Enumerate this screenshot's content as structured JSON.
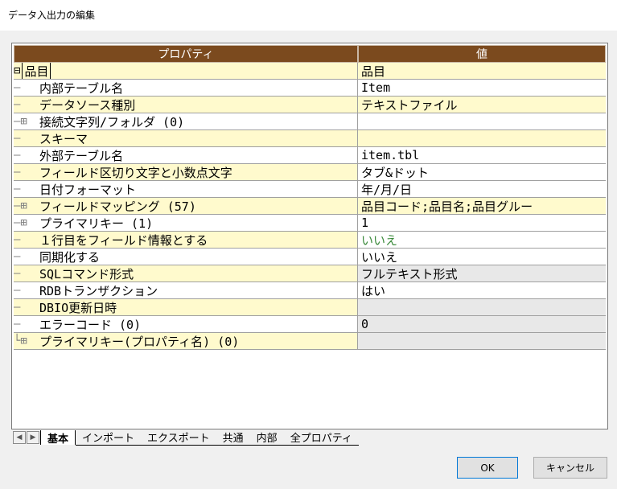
{
  "window": {
    "title": "データ入出力の編集"
  },
  "grid": {
    "headers": {
      "property": "プロパティ",
      "value": "値"
    },
    "rows": [
      {
        "tree": "⊟",
        "label": "品目",
        "value": "品目",
        "bg": "yellow",
        "vbg": "yellow",
        "root": true
      },
      {
        "tree": "―",
        "label": "内部テーブル名",
        "value": "Item",
        "bg": "white",
        "vbg": "white"
      },
      {
        "tree": "―",
        "label": "データソース種別",
        "value": "テキストファイル",
        "bg": "yellow",
        "vbg": "yellow"
      },
      {
        "tree": "―⊞",
        "label": "接続文字列/フォルダ (0)",
        "value": "",
        "bg": "white",
        "vbg": "white"
      },
      {
        "tree": "―",
        "label": "スキーマ",
        "value": "",
        "bg": "yellow",
        "vbg": "yellow"
      },
      {
        "tree": "―",
        "label": "外部テーブル名",
        "value": "item.tbl",
        "bg": "white",
        "vbg": "white"
      },
      {
        "tree": "―",
        "label": "フィールド区切り文字と小数点文字",
        "value": "タブ&ドット",
        "bg": "yellow",
        "vbg": "white"
      },
      {
        "tree": "―",
        "label": "日付フォーマット",
        "value": "年/月/日",
        "bg": "white",
        "vbg": "white"
      },
      {
        "tree": "―⊞",
        "label": "フィールドマッピング (57)",
        "value": "品目コード;品目名;品目グルー",
        "bg": "yellow",
        "vbg": "yellow"
      },
      {
        "tree": "―⊞",
        "label": "プライマリキー (1)",
        "value": "1",
        "bg": "white",
        "vbg": "white"
      },
      {
        "tree": "―",
        "label": "１行目をフィールド情報とする",
        "value": "いいえ",
        "bg": "yellow",
        "vbg": "white",
        "green": true
      },
      {
        "tree": "―",
        "label": "同期化する",
        "value": "いいえ",
        "bg": "white",
        "vbg": "white"
      },
      {
        "tree": "―",
        "label": "SQLコマンド形式",
        "value": "フルテキスト形式",
        "bg": "yellow",
        "vbg": "gray"
      },
      {
        "tree": "―",
        "label": "RDBトランザクション",
        "value": "はい",
        "bg": "white",
        "vbg": "white"
      },
      {
        "tree": "―",
        "label": "DBIO更新日時",
        "value": "",
        "bg": "yellow",
        "vbg": "gray"
      },
      {
        "tree": "―",
        "label": "エラーコード (0)",
        "value": "0",
        "bg": "white",
        "vbg": "gray"
      },
      {
        "tree": "└⊞",
        "label": "プライマリキー(プロパティ名) (0)",
        "value": "",
        "bg": "yellow",
        "vbg": "gray"
      }
    ]
  },
  "tabs": [
    "基本",
    "インポート",
    "エクスポート",
    "共通",
    "内部",
    "全プロパティ"
  ],
  "active_tab": "基本",
  "buttons": {
    "ok": "OK",
    "cancel": "キャンセル"
  }
}
